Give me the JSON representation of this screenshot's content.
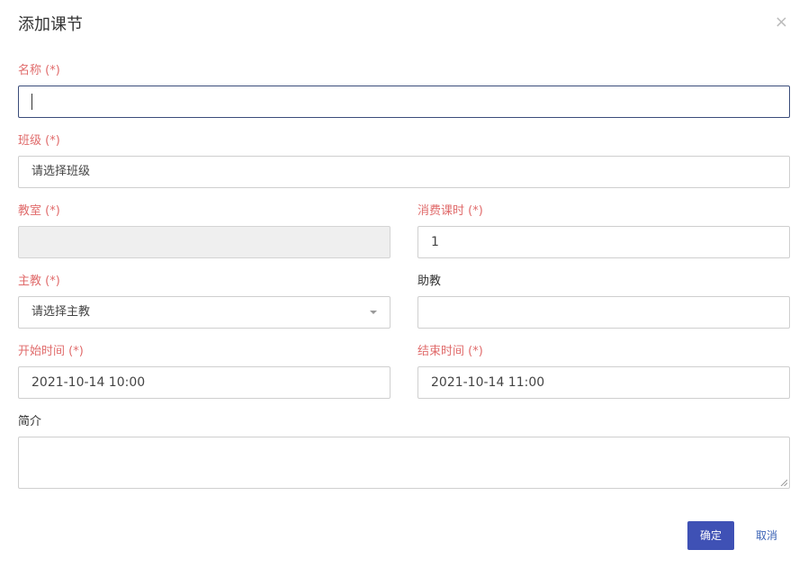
{
  "dialog": {
    "title": "添加课节",
    "close_glyph": "×"
  },
  "fields": {
    "name": {
      "label": "名称 (*)",
      "value": ""
    },
    "class": {
      "label": "班级 (*)",
      "value": "请选择班级"
    },
    "classroom": {
      "label": "教室 (*)",
      "value": ""
    },
    "hours": {
      "label": "消费课时 (*)",
      "value": "1"
    },
    "teacher": {
      "label": "主教 (*)",
      "value": "请选择主教"
    },
    "assistant": {
      "label": "助教",
      "value": ""
    },
    "start_time": {
      "label": "开始时间 (*)",
      "value": "2021-10-14 10:00"
    },
    "end_time": {
      "label": "结束时间 (*)",
      "value": "2021-10-14 11:00"
    },
    "intro": {
      "label": "简介",
      "value": ""
    }
  },
  "buttons": {
    "confirm": "确定",
    "cancel": "取消"
  },
  "colors": {
    "required_label": "#e06b6b",
    "primary": "#3f51b5",
    "link": "#3a62b5",
    "focus_border": "#3a4c7a"
  },
  "icons": {
    "close": "close-icon",
    "dropdown": "chevron-down-icon",
    "resize": "resize-handle-icon"
  }
}
